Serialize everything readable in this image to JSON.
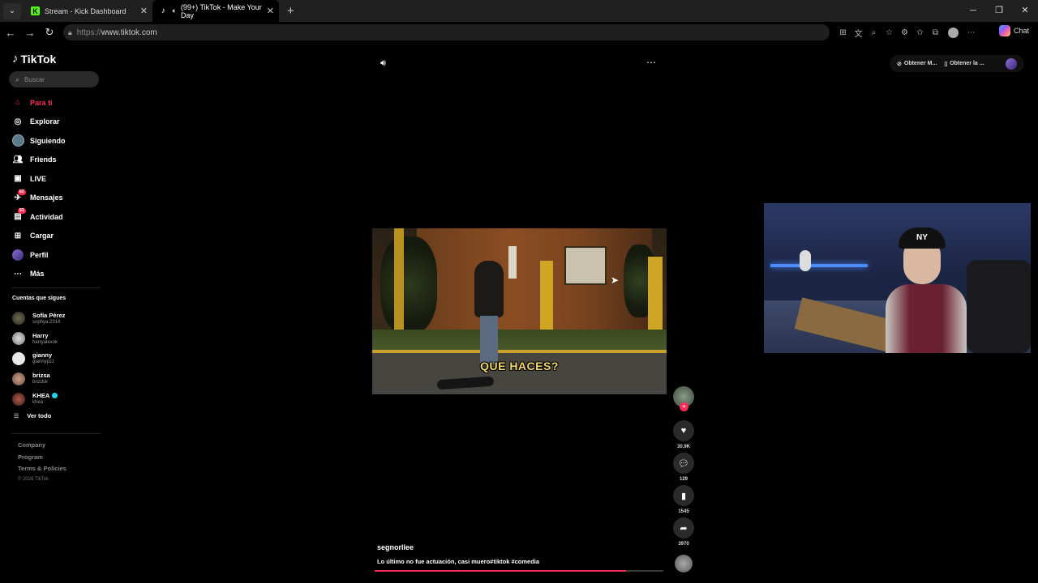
{
  "browser": {
    "tabs": [
      {
        "title": "Stream - Kick Dashboard",
        "favicon": "kick-icon",
        "active": false
      },
      {
        "title": "(99+) TikTok - Make Your Day",
        "favicon": "tiktok-icon",
        "active": true
      }
    ],
    "url_protocol": "https://",
    "url_host": "www.tiktok.com",
    "chat_label": "Chat"
  },
  "sidebar": {
    "logo": "TikTok",
    "search_placeholder": "Buscar",
    "nav": [
      {
        "label": "Para ti",
        "icon": "home-icon",
        "active": true
      },
      {
        "label": "Explorar",
        "icon": "compass-icon"
      },
      {
        "label": "Siguiendo",
        "icon": "following-avatar-icon"
      },
      {
        "label": "Friends",
        "icon": "friends-icon"
      },
      {
        "label": "LIVE",
        "icon": "live-icon"
      },
      {
        "label": "Mensajes",
        "icon": "messages-icon",
        "badge": "62"
      },
      {
        "label": "Actividad",
        "icon": "activity-icon",
        "badge": "51"
      },
      {
        "label": "Cargar",
        "icon": "upload-icon"
      },
      {
        "label": "Perfil",
        "icon": "profile-icon"
      },
      {
        "label": "Más",
        "icon": "more-icon"
      }
    ],
    "following_title": "Cuentas que sigues",
    "following": [
      {
        "name": "Sofía Pérez",
        "handle": "sophya.2314"
      },
      {
        "name": "Harry",
        "handle": "harryalexok"
      },
      {
        "name": "gianny",
        "handle": "giannypzz"
      },
      {
        "name": "brizsa",
        "handle": "brizdsk"
      },
      {
        "name": "KHEA",
        "handle": "khea",
        "verified": true
      }
    ],
    "see_all": "Ver todo",
    "footer": {
      "company": "Company",
      "program": "Program",
      "terms": "Terms & Policies",
      "copyright": "© 2026 TikTok"
    }
  },
  "topbar": {
    "get_coins": "Obtener M...",
    "get_app": "Obtener la ..."
  },
  "video": {
    "caption_overlay": "QUE HACES?",
    "author": "segnorllee",
    "description": "Lo último no fue actuación, casi muero#tiktok #comedia",
    "progress_fraction": 0.87,
    "likes": "30.9K",
    "comments": "129",
    "saves": "1545",
    "shares": "3970"
  },
  "colors": {
    "accent": "#fe2c55",
    "caption": "#f5d86a"
  }
}
